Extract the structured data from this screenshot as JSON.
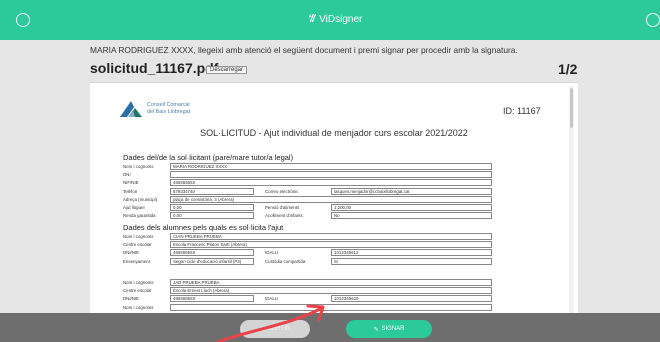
{
  "app": {
    "brand": "ViDsigner"
  },
  "header": {
    "intro": "MARIA RODRIGUEZ XXXX, llegeixi amb atenció el següent document i premi signar per procedir amb la signatura.",
    "filename": "solicitud_11167.pdf",
    "download_label": "Descarregar",
    "pager": "1/2"
  },
  "document": {
    "logo_line1": "Consell Comarcal",
    "logo_line2": "del Baix Llobregat",
    "id": "ID: 11167",
    "title": "SOL·LICITUD - Ajut individual de menjador curs escolar 2021/2022",
    "section1": "Dades del/de la sol·licitant (pare/mare tutor/a legal)",
    "applicant": [
      {
        "label": "Nom i cognoms",
        "value": "MARIA RODRIGUEZ XXXX"
      },
      {
        "label": "DNI",
        "value": ""
      },
      {
        "label": "NIF/NIE",
        "value": "46655555X"
      },
      {
        "label": "Telèfon",
        "value": "679334740",
        "label2": "Correu electrònic",
        "value2": "lasques.menjador@ccbaixllobregat.cat"
      },
      {
        "label": "Adreça (municipi)",
        "value": "plaҫa de consistòria, 3 (Abrera)"
      },
      {
        "label": "Ajut lloguer",
        "value": "0,00",
        "label2": "Pensió d'aliments",
        "value2": "1.200,00"
      },
      {
        "label": "Renda garantida",
        "value": "0,00",
        "label2": "Acolliment d'infants",
        "value2": "No"
      }
    ],
    "section2": "Dades dels alumnes pels quals es sol·licita l'ajut",
    "student1": [
      {
        "label": "Nom i cognoms",
        "value": "CIAN PRUEBA PRUEBA"
      },
      {
        "label": "Centre escolar",
        "value": "Escola Francesc Platon Sartí (Abrera)"
      },
      {
        "label": "DNI/NIE",
        "value": "46655555X",
        "label2": "IDALU",
        "value2": "1012345612"
      },
      {
        "label": "Ensenyament",
        "value": "Segon cicle d'educació infantil (P3)",
        "label2": "Custòdia compartida",
        "value2": "Si"
      }
    ],
    "student2": [
      {
        "label": "Nom i cognoms",
        "value": "JAD PRUEBA PRUEBA"
      },
      {
        "label": "Centre escolar",
        "value": "Escola Ernest Lluch (Abrera)"
      },
      {
        "label": "DNI/NIE",
        "value": "46655555X",
        "label2": "IDALU",
        "value2": "1012345620"
      },
      {
        "label": "Nom i cognoms",
        "value": ""
      }
    ]
  },
  "actions": {
    "back_label": "SORTIR",
    "sign_label": "SIGNAR"
  }
}
